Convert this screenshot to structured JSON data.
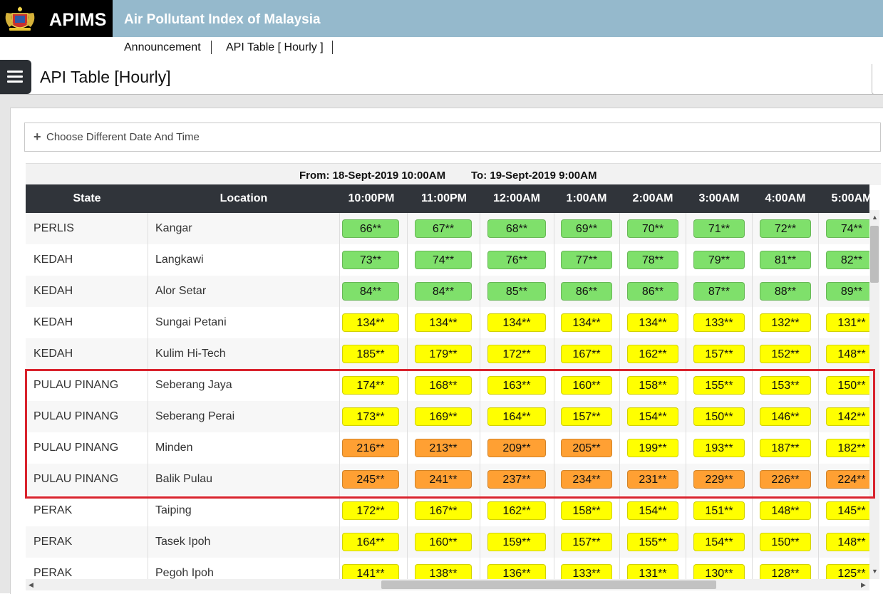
{
  "header": {
    "brand": "APIMS",
    "title": "Air Pollutant Index of Malaysia",
    "crest_icon": "malaysia-crest-icon"
  },
  "nav": {
    "items": [
      "Announcement",
      "API Table [ Hourly ]"
    ]
  },
  "page": {
    "title": "API Table [Hourly]"
  },
  "date_picker": {
    "label": "Choose Different Date And Time"
  },
  "range": {
    "from": "From: 18-Sept-2019  10:00AM",
    "to": "To: 19-Sept-2019  9:00AM"
  },
  "colors": {
    "good": "#7fe06b",
    "moderate": "#ffff00",
    "unhealthy": "#ffa033",
    "header_bar": "#95b9cc",
    "highlight": "#d9232d"
  },
  "table": {
    "headers": [
      "State",
      "Location",
      "10:00PM",
      "11:00PM",
      "12:00AM",
      "1:00AM",
      "2:00AM",
      "3:00AM",
      "4:00AM",
      "5:00AM"
    ],
    "rows": [
      {
        "state": "PERLIS",
        "location": "Kangar",
        "values": [
          "66**",
          "67**",
          "68**",
          "69**",
          "70**",
          "71**",
          "72**",
          "74**"
        ]
      },
      {
        "state": "KEDAH",
        "location": "Langkawi",
        "values": [
          "73**",
          "74**",
          "76**",
          "77**",
          "78**",
          "79**",
          "81**",
          "82**"
        ]
      },
      {
        "state": "KEDAH",
        "location": "Alor Setar",
        "values": [
          "84**",
          "84**",
          "85**",
          "86**",
          "86**",
          "87**",
          "88**",
          "89**"
        ]
      },
      {
        "state": "KEDAH",
        "location": "Sungai Petani",
        "values": [
          "134**",
          "134**",
          "134**",
          "134**",
          "134**",
          "133**",
          "132**",
          "131**"
        ]
      },
      {
        "state": "KEDAH",
        "location": "Kulim Hi-Tech",
        "values": [
          "185**",
          "179**",
          "172**",
          "167**",
          "162**",
          "157**",
          "152**",
          "148**"
        ]
      },
      {
        "state": "PULAU PINANG",
        "location": "Seberang Jaya",
        "values": [
          "174**",
          "168**",
          "163**",
          "160**",
          "158**",
          "155**",
          "153**",
          "150**"
        ]
      },
      {
        "state": "PULAU PINANG",
        "location": "Seberang Perai",
        "values": [
          "173**",
          "169**",
          "164**",
          "157**",
          "154**",
          "150**",
          "146**",
          "142**"
        ]
      },
      {
        "state": "PULAU PINANG",
        "location": "Minden",
        "values": [
          "216**",
          "213**",
          "209**",
          "205**",
          "199**",
          "193**",
          "187**",
          "182**"
        ]
      },
      {
        "state": "PULAU PINANG",
        "location": "Balik Pulau",
        "values": [
          "245**",
          "241**",
          "237**",
          "234**",
          "231**",
          "229**",
          "226**",
          "224**"
        ]
      },
      {
        "state": "PERAK",
        "location": "Taiping",
        "values": [
          "172**",
          "167**",
          "162**",
          "158**",
          "154**",
          "151**",
          "148**",
          "145**"
        ]
      },
      {
        "state": "PERAK",
        "location": "Tasek Ipoh",
        "values": [
          "164**",
          "160**",
          "159**",
          "157**",
          "155**",
          "154**",
          "150**",
          "148**"
        ]
      },
      {
        "state": "PERAK",
        "location": "Pegoh Ipoh",
        "values": [
          "141**",
          "138**",
          "136**",
          "133**",
          "131**",
          "130**",
          "128**",
          "125**"
        ]
      }
    ]
  }
}
